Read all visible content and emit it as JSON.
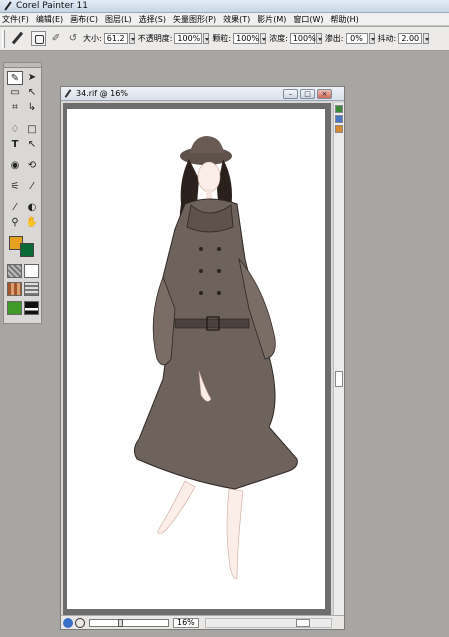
{
  "app": {
    "title": "Corel Painter 11"
  },
  "menu": [
    "文件(F)",
    "编辑(E)",
    "画布(C)",
    "图层(L)",
    "选择(S)",
    "矢量图形(P)",
    "效果(T)",
    "影片(M)",
    "窗口(W)",
    "帮助(H)"
  ],
  "properties": {
    "size_label": "大小:",
    "size_value": "61.2",
    "opacity_label": "不透明度:",
    "opacity_value": "100%",
    "grain_label": "颗粒:",
    "grain_value": "100%",
    "resat_label": "浓度:",
    "resat_value": "100%",
    "bleed_label": "渗出:",
    "bleed_value": "0%",
    "jitter_label": "抖动:",
    "jitter_value": "2.00"
  },
  "document": {
    "title": "34.rif @ 16%",
    "zoom": "16%"
  },
  "colors": {
    "main": "#e8a020",
    "additional": "#0a6a35",
    "coat": "#6e625c"
  }
}
